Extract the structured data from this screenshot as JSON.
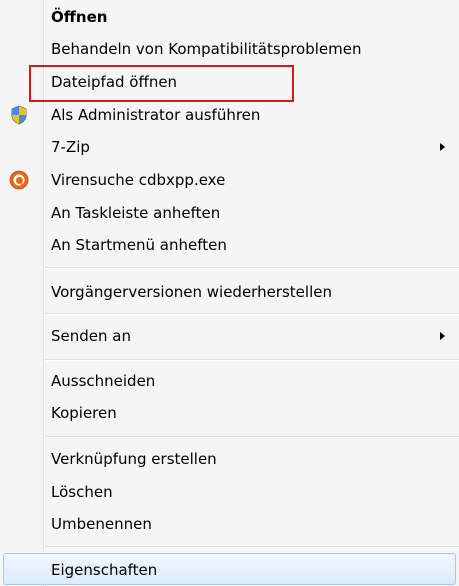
{
  "menu": {
    "items": [
      {
        "label": "Öffnen",
        "bold": true
      },
      {
        "label": "Behandeln von Kompatibilitätsproblemen"
      },
      {
        "label": "Dateipfad öffnen",
        "highlighted_annotation": true
      },
      {
        "label": "Als Administrator ausführen",
        "icon": "uac-shield-icon"
      },
      {
        "label": "7-Zip",
        "submenu": true
      },
      {
        "label": "Virensuche cdbxpp.exe",
        "icon": "antivirus-icon"
      },
      {
        "label": "An Taskleiste anheften"
      },
      {
        "label": "An Startmenü anheften"
      },
      {
        "label": "Vorgängerversionen wiederherstellen"
      },
      {
        "label": "Senden an",
        "submenu": true
      },
      {
        "label": "Ausschneiden"
      },
      {
        "label": "Kopieren"
      },
      {
        "label": "Verknüpfung erstellen"
      },
      {
        "label": "Löschen"
      },
      {
        "label": "Umbenennen"
      },
      {
        "label": "Eigenschaften",
        "hovered": true
      }
    ]
  },
  "colors": {
    "annotation_border": "#d81818",
    "hover_border": "#a9c8ec",
    "menu_background": "#f5f5f5"
  }
}
